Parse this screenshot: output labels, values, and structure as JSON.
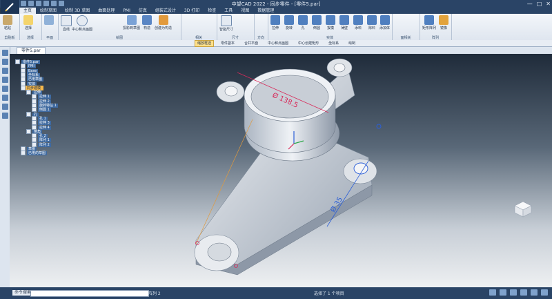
{
  "title": "中望CAD 2022 - 同步零件 - [零件5.par]",
  "window_controls": [
    "—",
    "□",
    "✕"
  ],
  "tabs": [
    "主页",
    "绘制草图",
    "绘制 3D 草图",
    "曲面处理",
    "PMI",
    "仿真",
    "组装式设计",
    "3D 打印",
    "检查",
    "工具",
    "视图",
    "数据管理"
  ],
  "active_tab": "主页",
  "ribbon_groups": [
    {
      "title": "剪贴板",
      "buttons": [
        "粘贴"
      ]
    },
    {
      "title": "选择",
      "buttons": [
        "选择"
      ]
    },
    {
      "title": "平面",
      "buttons": []
    },
    {
      "title": "绘图",
      "buttons": [
        "直线",
        "中心和点画圆",
        "投影到草图",
        "构造",
        "创建为构造"
      ]
    },
    {
      "title": "相关",
      "buttons": []
    },
    {
      "title": "尺寸",
      "buttons": [
        "智能尺寸"
      ]
    },
    {
      "title": "方向",
      "buttons": []
    },
    {
      "title": "实体",
      "buttons": [
        "拉伸",
        "旋转",
        "孔",
        "倒圆",
        "拔模",
        "薄壁",
        "添料",
        "除料",
        "添加体"
      ]
    },
    {
      "title": "面相关",
      "buttons": []
    },
    {
      "title": "阵列",
      "buttons": [
        "矩形阵列",
        "镜像"
      ]
    }
  ],
  "command_bar": [
    "缩放框选",
    "零件副本",
    "合并平面",
    "中心和点画圆",
    "中心创建矩形",
    "坐标系",
    "绘制"
  ],
  "doc_tab": "零件5.par",
  "tree": [
    {
      "text": "零件5.par",
      "indent": 0,
      "sel": false
    },
    {
      "text": "PMI",
      "indent": 1,
      "sel": false
    },
    {
      "text": "Base",
      "indent": 1,
      "sel": false
    },
    {
      "text": "坐标系",
      "indent": 1,
      "sel": false
    },
    {
      "text": "已用草图",
      "indent": 1,
      "sel": false
    },
    {
      "text": "实体",
      "indent": 1,
      "sel": false
    },
    {
      "text": "同步建模",
      "indent": 1,
      "sel": true
    },
    {
      "text": "拉伸",
      "indent": 2,
      "sel": false
    },
    {
      "text": "拉伸 1",
      "indent": 3,
      "sel": false
    },
    {
      "text": "拉伸 2",
      "indent": 3,
      "sel": false
    },
    {
      "text": "旋转特征 1",
      "indent": 3,
      "sel": false
    },
    {
      "text": "倒圆 1",
      "indent": 3,
      "sel": false
    },
    {
      "text": "孔",
      "indent": 2,
      "sel": false
    },
    {
      "text": "孔 1",
      "indent": 3,
      "sel": false
    },
    {
      "text": "拉伸 3",
      "indent": 3,
      "sel": false
    },
    {
      "text": "拉伸 4",
      "indent": 3,
      "sel": false
    },
    {
      "text": "倒角",
      "indent": 2,
      "sel": false
    },
    {
      "text": "孔 2",
      "indent": 3,
      "sel": false
    },
    {
      "text": "阵列 1",
      "indent": 3,
      "sel": false
    },
    {
      "text": "阵列 2",
      "indent": 3,
      "sel": false
    },
    {
      "text": "草图",
      "indent": 1,
      "sel": false
    },
    {
      "text": "已用的草图",
      "indent": 1,
      "sel": false
    }
  ],
  "dimensions": {
    "top": "Ø 138.5",
    "right": "Ø 35"
  },
  "status": {
    "cmd_label": "命令搜索",
    "mid": "阵列 2",
    "right": "选择了 1 个项目"
  }
}
